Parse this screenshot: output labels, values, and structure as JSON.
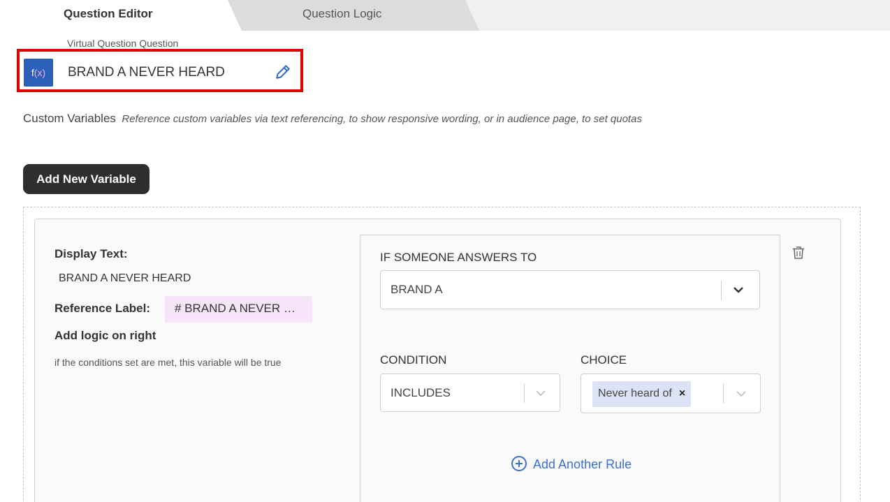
{
  "tabs": [
    {
      "label": "Question Editor",
      "active": true
    },
    {
      "label": "Question Logic",
      "active": false
    }
  ],
  "question": {
    "type_label": "Virtual Question Question",
    "icon": "f(x)",
    "icon_fn": "f",
    "icon_args": "(x)",
    "name": "BRAND A NEVER HEARD"
  },
  "custom_variables": {
    "title": "Custom Variables",
    "description": "Reference custom variables via text referencing, to show responsive wording, or in audience page, to set quotas",
    "add_button": "Add New Variable"
  },
  "variable": {
    "display_text_label": "Display Text:",
    "display_text_value": "BRAND A NEVER HEARD",
    "reference_label": "Reference Label:",
    "reference_chip": "#  BRAND A NEVER …",
    "logic_heading": "Add logic on right",
    "logic_hint": "if the conditions set are met, this variable will be true"
  },
  "rule": {
    "answers_label": "IF SOMEONE ANSWERS TO",
    "answers_value": "BRAND A",
    "condition_label": "CONDITION",
    "condition_value": "INCLUDES",
    "choice_label": "CHOICE",
    "choice_tag": "Never heard of",
    "choice_tag_remove": "×",
    "add_rule": "Add Another Rule"
  },
  "colors": {
    "highlight_border": "#e00000",
    "fx_icon_bg": "#2b5fb8",
    "link_blue": "#3b6fd4",
    "button_dark": "#2e2e2e",
    "ref_chip_bg": "#f6e5f8",
    "tag_bg": "#dbe3f4"
  },
  "icons": [
    "function-icon",
    "pencil-icon",
    "trash-icon",
    "chevron-down-icon",
    "close-icon",
    "plus-circle-icon"
  ]
}
